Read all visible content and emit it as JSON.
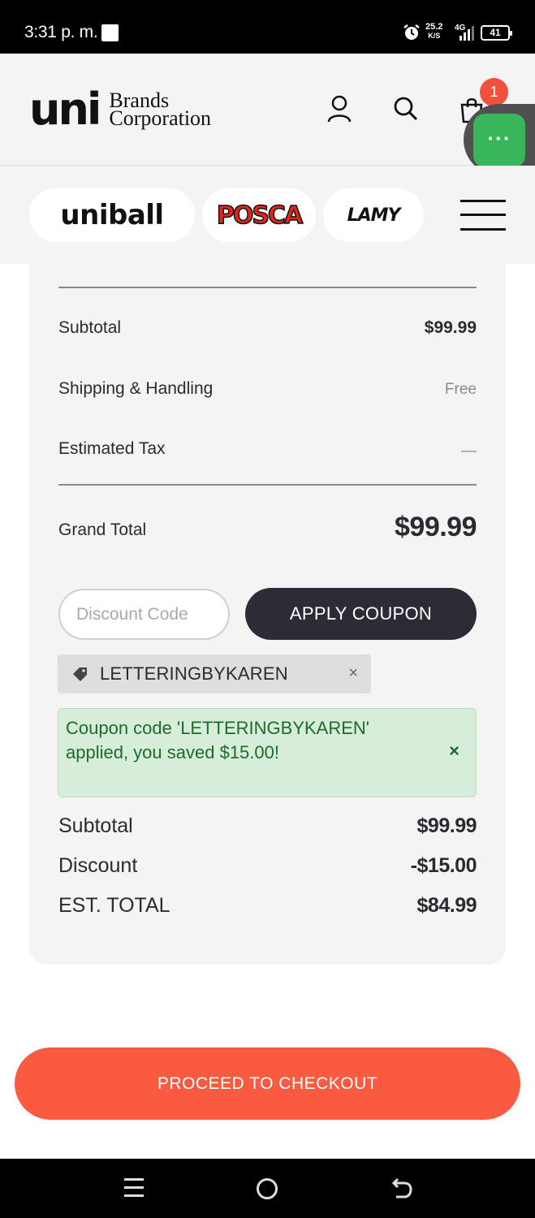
{
  "status_bar": {
    "time": "3:31 p. m.",
    "net_speed_value": "25.2",
    "net_speed_unit": "K/S",
    "network": "4G",
    "battery": "41"
  },
  "header": {
    "logo_uni": "uni",
    "logo_brands": "Brands",
    "logo_corporation": "Corporation",
    "cart_count": "1",
    "chat_icon": "···"
  },
  "brands": {
    "uniball": "uniball",
    "posca": "POSCA",
    "lamy": "LAMY"
  },
  "summary": {
    "subtotal_label": "Subtotal",
    "subtotal_value": "$99.99",
    "shipping_label": "Shipping & Handling",
    "shipping_value": "Free",
    "tax_label": "Estimated Tax",
    "tax_value": "—",
    "grand_total_label": "Grand Total",
    "grand_total_value": "$99.99"
  },
  "coupon": {
    "input_placeholder": "Discount Code",
    "input_value": "",
    "apply_label": "APPLY COUPON",
    "applied_code": "LETTERINGBYKAREN",
    "chip_remove": "×",
    "success_message": "Coupon code 'LETTERINGBYKAREN' applied, you saved $15.00!",
    "success_close": "×"
  },
  "totals": {
    "subtotal_label": "Subtotal",
    "subtotal_value": "$99.99",
    "discount_label": "Discount",
    "discount_value": "-$15.00",
    "est_total_label": "EST. TOTAL",
    "est_total_value": "$84.99"
  },
  "checkout": {
    "label": "PROCEED TO CHECKOUT"
  },
  "colors": {
    "accent_checkout": "#fa5a40",
    "apply_button": "#2b2c35",
    "success_bg": "#d6edd9",
    "success_text": "#1d6b2c",
    "chat_green": "#39b55a",
    "badge_red": "#f0503c"
  }
}
